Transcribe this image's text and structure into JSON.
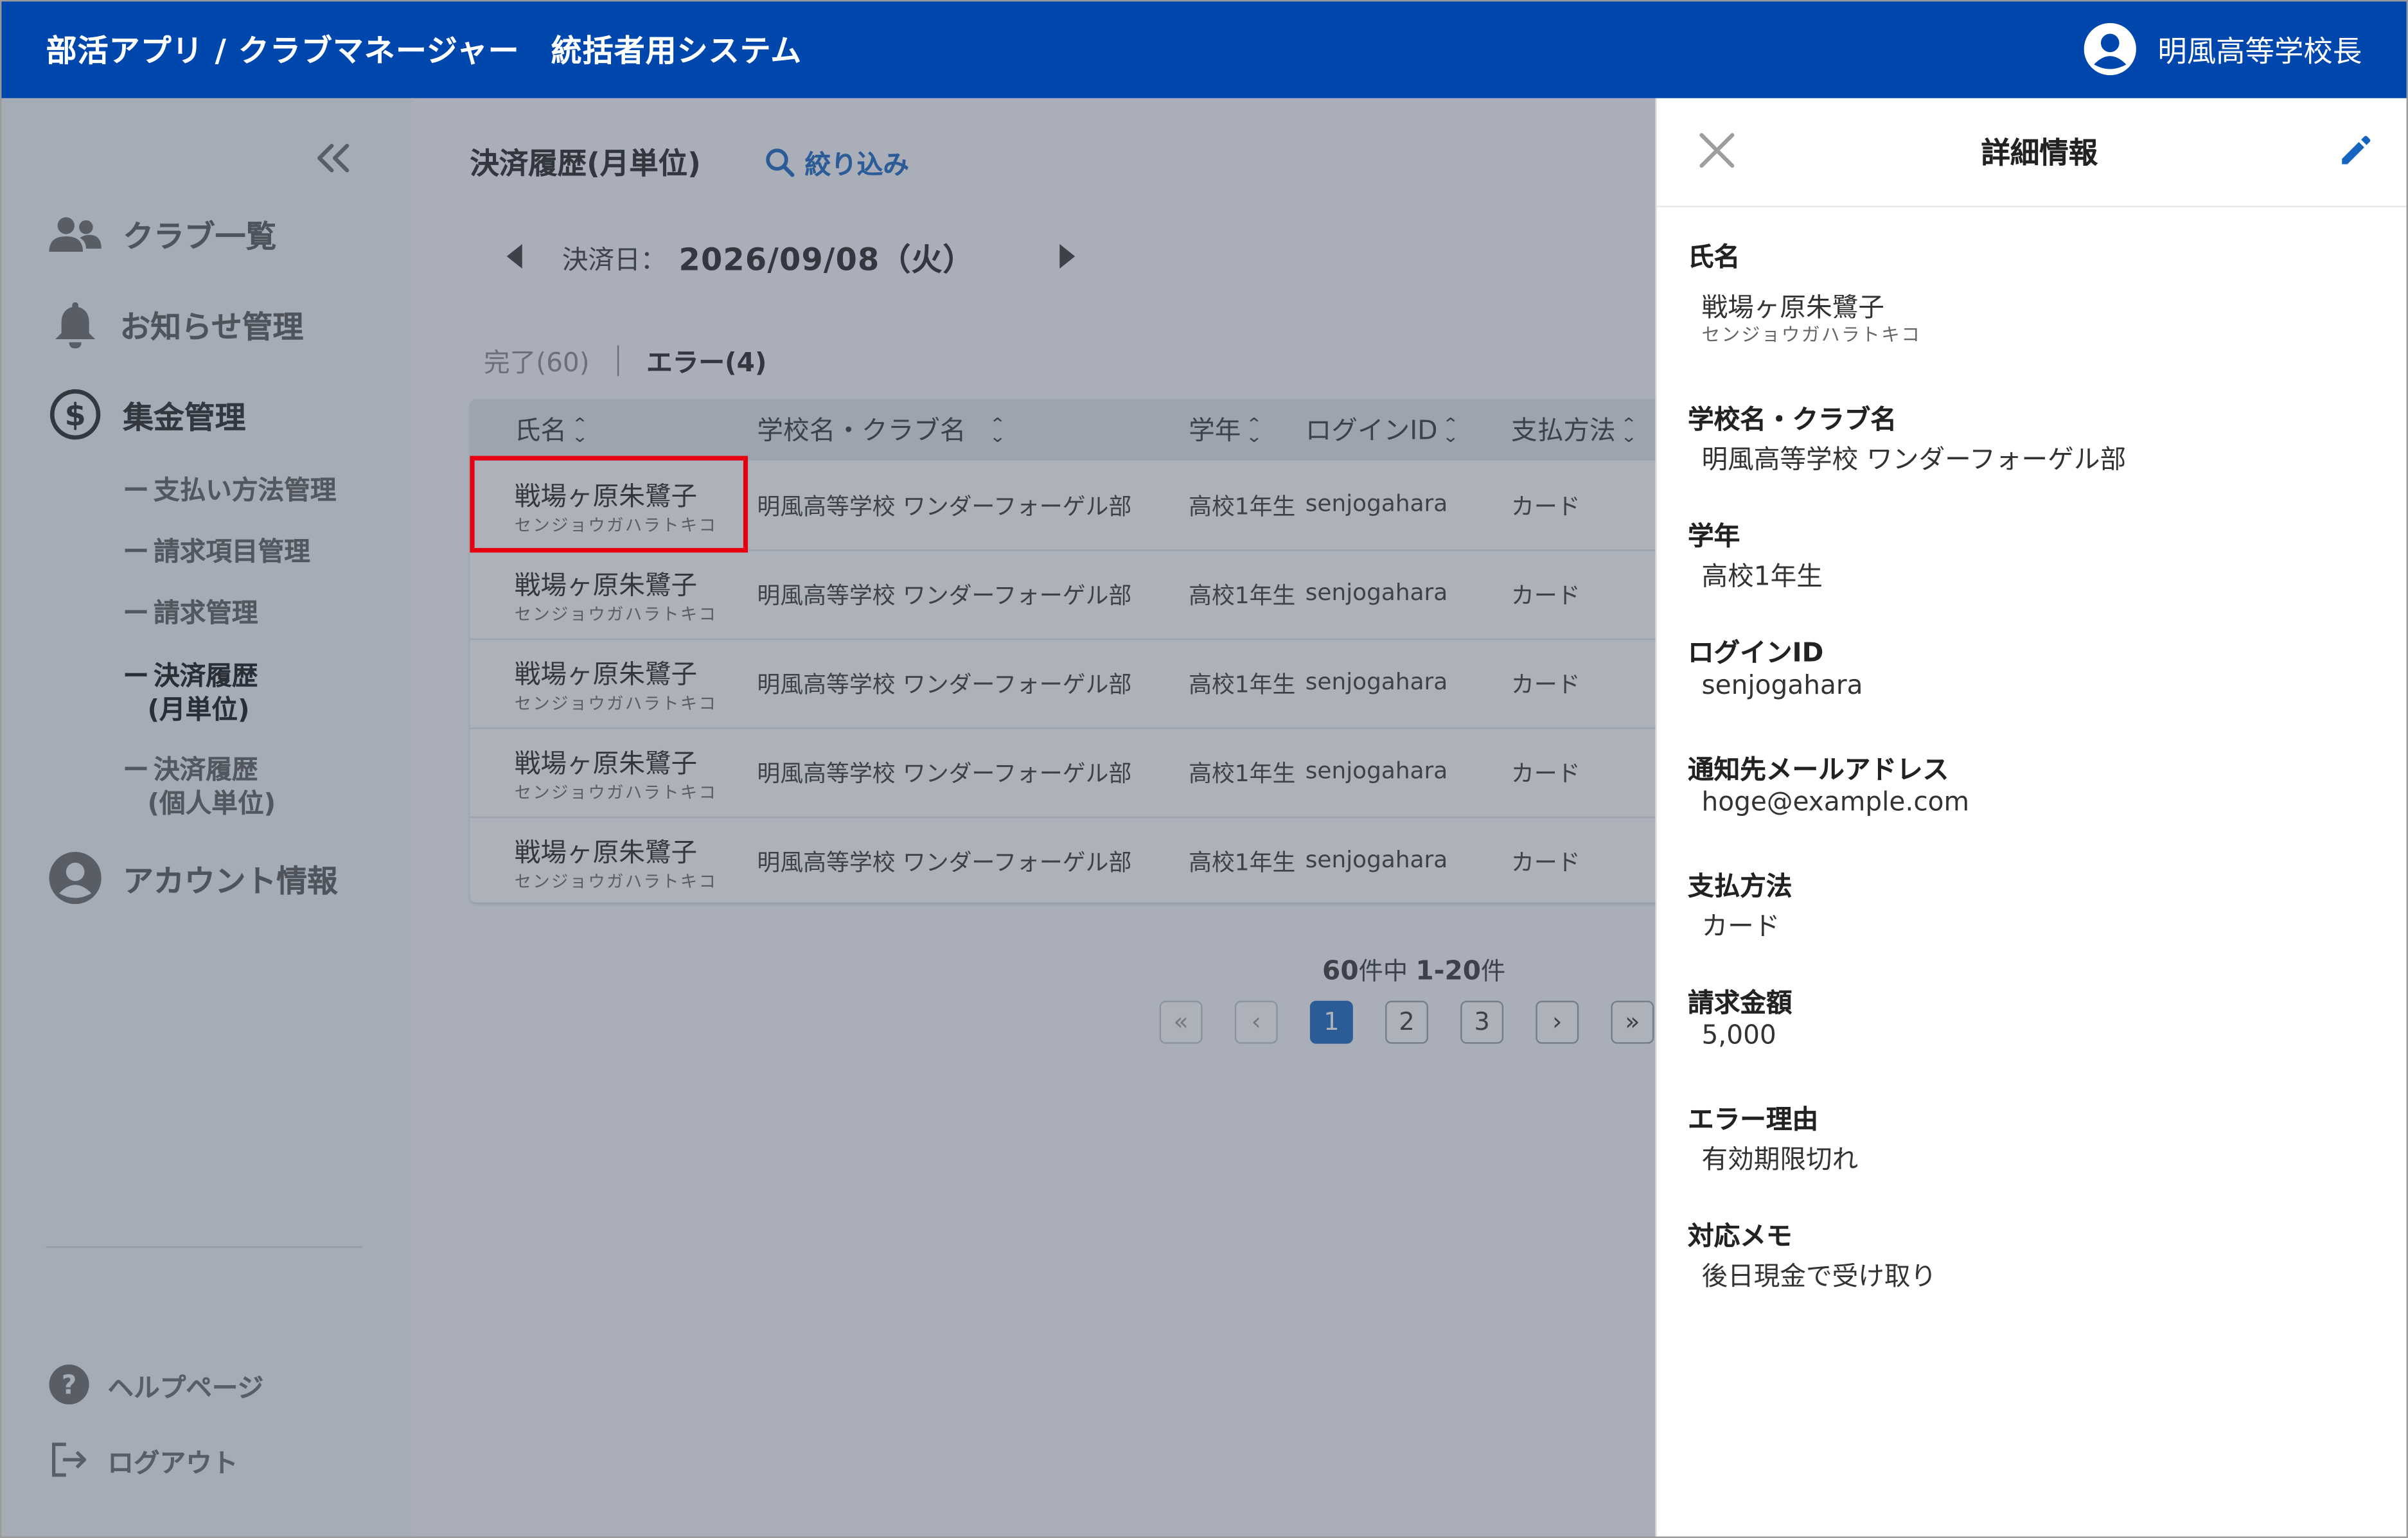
{
  "header": {
    "title": "部活アプリ / クラブマネージャー　統括者用システム",
    "user_name": "明風高等学校長"
  },
  "sidebar": {
    "nav": [
      {
        "label": "クラブ一覧"
      },
      {
        "label": "お知らせ管理"
      },
      {
        "label": "集金管理"
      },
      {
        "label": "アカウント情報"
      }
    ],
    "sub_items": [
      {
        "label": "支払い方法管理"
      },
      {
        "label": "請求項目管理"
      },
      {
        "label": "請求管理"
      },
      {
        "label_line1": "決済履歴",
        "label_line2": "(月単位)"
      },
      {
        "label_line1": "決済履歴",
        "label_line2": "(個人単位)"
      }
    ],
    "footer": {
      "help": "ヘルプページ",
      "logout": "ログアウト"
    }
  },
  "main": {
    "title": "決済履歴(月単位)",
    "filter_label": "絞り込み",
    "date_label": "決済日：",
    "date_value": "2026/09/08（火）",
    "tabs": [
      {
        "label": "完了(60)",
        "active": false
      },
      {
        "label": "エラー(4)",
        "active": true
      }
    ],
    "table": {
      "columns": [
        "氏名",
        "学校名・クラブ名",
        "学年",
        "ログインID",
        "支払方法"
      ],
      "rows": [
        {
          "name": "戦場ヶ原朱鷺子",
          "kana": "センジョウガハラトキコ",
          "school_club": "明風高等学校 ワンダーフォーゲル部",
          "grade": "高校1年生",
          "login_id": "senjogahara",
          "payment": "カード"
        },
        {
          "name": "戦場ヶ原朱鷺子",
          "kana": "センジョウガハラトキコ",
          "school_club": "明風高等学校 ワンダーフォーゲル部",
          "grade": "高校1年生",
          "login_id": "senjogahara",
          "payment": "カード"
        },
        {
          "name": "戦場ヶ原朱鷺子",
          "kana": "センジョウガハラトキコ",
          "school_club": "明風高等学校 ワンダーフォーゲル部",
          "grade": "高校1年生",
          "login_id": "senjogahara",
          "payment": "カード"
        },
        {
          "name": "戦場ヶ原朱鷺子",
          "kana": "センジョウガハラトキコ",
          "school_club": "明風高等学校 ワンダーフォーゲル部",
          "grade": "高校1年生",
          "login_id": "senjogahara",
          "payment": "カード"
        },
        {
          "name": "戦場ヶ原朱鷺子",
          "kana": "センジョウガハラトキコ",
          "school_club": "明風高等学校 ワンダーフォーゲル部",
          "grade": "高校1年生",
          "login_id": "senjogahara",
          "payment": "カード"
        }
      ]
    },
    "pagination": {
      "total": "60",
      "total_suffix": "件中",
      "range": "1-20",
      "range_suffix": "件",
      "pages": [
        "1",
        "2",
        "3"
      ],
      "current": "1"
    }
  },
  "drawer": {
    "title": "詳細情報",
    "fields": {
      "name": {
        "label": "氏名",
        "value": "戦場ヶ原朱鷺子",
        "sub": "センジョウガハラトキコ"
      },
      "school_club": {
        "label": "学校名・クラブ名",
        "value": "明風高等学校 ワンダーフォーゲル部"
      },
      "grade": {
        "label": "学年",
        "value": "高校1年生"
      },
      "login_id": {
        "label": "ログインID",
        "value": "senjogahara"
      },
      "email": {
        "label": "通知先メールアドレス",
        "value": "hoge@example.com"
      },
      "payment": {
        "label": "支払方法",
        "value": "カード"
      },
      "amount": {
        "label": "請求金額",
        "value": "5,000"
      },
      "error_reason": {
        "label": "エラー理由",
        "value": "有効期限切れ"
      },
      "memo": {
        "label": "対応メモ",
        "value": "後日現金で受け取り"
      }
    }
  },
  "colors": {
    "header_bg": "#0047ad",
    "accent": "#1565c0",
    "highlight": "#e60012"
  },
  "icons": [
    "user-circle-icon",
    "double-chevron-left-icon",
    "people-icon",
    "bell-icon",
    "dollar-circle-icon",
    "account-circle-icon",
    "help-circle-icon",
    "logout-icon",
    "search-icon",
    "caret-left-icon",
    "caret-right-icon",
    "sort-icon",
    "close-icon",
    "pencil-icon"
  ]
}
